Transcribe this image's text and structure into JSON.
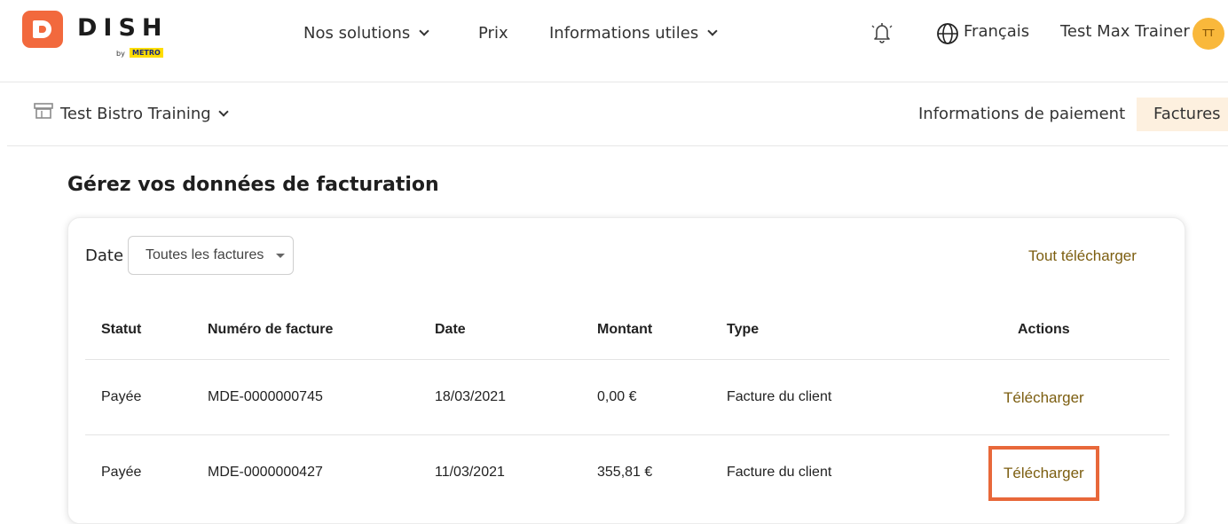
{
  "brand": {
    "name": "DISH",
    "by": "by",
    "partner": "METRO"
  },
  "nav": {
    "solutions": "Nos solutions",
    "pricing": "Prix",
    "info": "Informations utiles",
    "language": "Français",
    "user_name": "Test Max Trainer",
    "user_initials": "TT",
    "icons": {
      "notifications": "bell-icon",
      "language": "globe-icon"
    }
  },
  "subnav": {
    "store": "Test Bistro Training",
    "tab_payment": "Informations de paiement",
    "tab_invoices": "Factures"
  },
  "page": {
    "title": "Gérez vos données de facturation"
  },
  "filters": {
    "date_label": "Date",
    "date_value": "Toutes les factures",
    "download_all": "Tout télécharger"
  },
  "table": {
    "headers": {
      "status": "Statut",
      "number": "Numéro de facture",
      "date": "Date",
      "amount": "Montant",
      "type": "Type",
      "actions": "Actions"
    },
    "rows": [
      {
        "status": "Payée",
        "number": "MDE-0000000745",
        "date": "18/03/2021",
        "amount": "0,00 €",
        "type": "Facture du client",
        "action": "Télécharger"
      },
      {
        "status": "Payée",
        "number": "MDE-0000000427",
        "date": "11/03/2021",
        "amount": "355,81 €",
        "type": "Facture du client",
        "action": "Télécharger"
      }
    ]
  },
  "colors": {
    "brand_orange": "#f2693d",
    "link_brown": "#7c5e10",
    "active_tab_bg": "#fdf0df",
    "avatar": "#f9b83b",
    "highlight": "#e8683a"
  }
}
